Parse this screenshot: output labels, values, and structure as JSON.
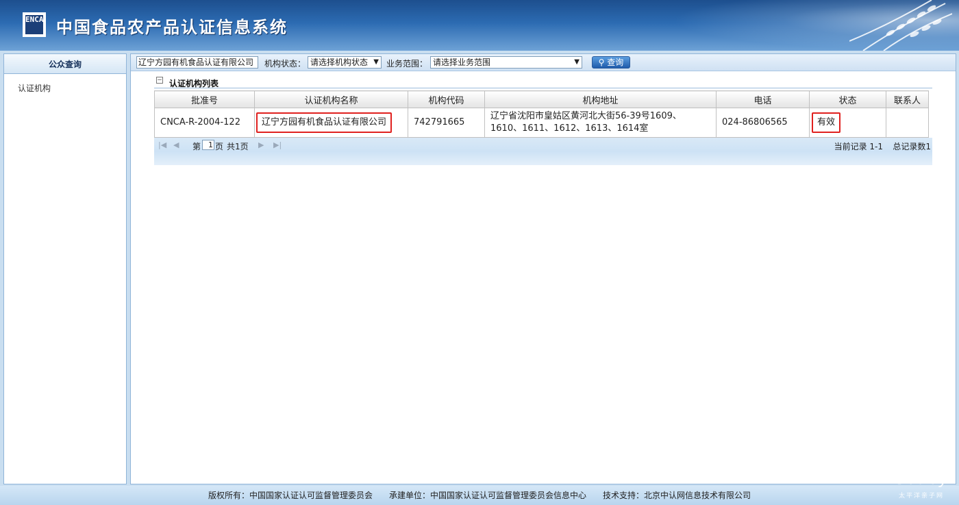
{
  "header": {
    "logo_text": "ENCA",
    "title": "中国食品农产品认证信息系统"
  },
  "sidebar": {
    "title": "公众查询",
    "items": [
      {
        "label": "认证机构"
      }
    ]
  },
  "toolbar": {
    "org_name_value": "辽宁方园有机食品认证有限公司",
    "status_label": "机构状态：",
    "status_selected": "请选择机构状态",
    "scope_label": "业务范围：",
    "scope_selected": "请选择业务范围",
    "search_label": "查询"
  },
  "section": {
    "title": "认证机构列表",
    "collapse_symbol": "−"
  },
  "table": {
    "columns": [
      "批准号",
      "认证机构名称",
      "机构代码",
      "机构地址",
      "电话",
      "状态",
      "联系人"
    ],
    "rows": [
      {
        "approval_no": "CNCA-R-2004-122",
        "name": "辽宁方园有机食品认证有限公司",
        "code": "742791665",
        "address": "辽宁省沈阳市皇姑区黄河北大街56-39号1609、1610、1611、1612、1613、1614室",
        "phone": "024-86806565",
        "status": "有效",
        "contact": ""
      }
    ]
  },
  "pager": {
    "page_prefix": "第",
    "current_page": "1",
    "page_suffix": "页",
    "total_pages": "共1页",
    "record_range": "当前记录 1-1",
    "total_records": "总记录数1"
  },
  "footer": {
    "text": "版权所有：中国国家认证认可监督管理委员会　　承建单位：中国国家认证认可监督管理委员会信息中心　　技术支持：北京中认网信息技术有限公司"
  },
  "watermark": {
    "brand": "PCbaby",
    "sub": "太平洋亲子网"
  },
  "colors": {
    "header_dark": "#1d4f8e",
    "highlight_border": "#e0201e",
    "panel_border": "#8fb4d8"
  }
}
